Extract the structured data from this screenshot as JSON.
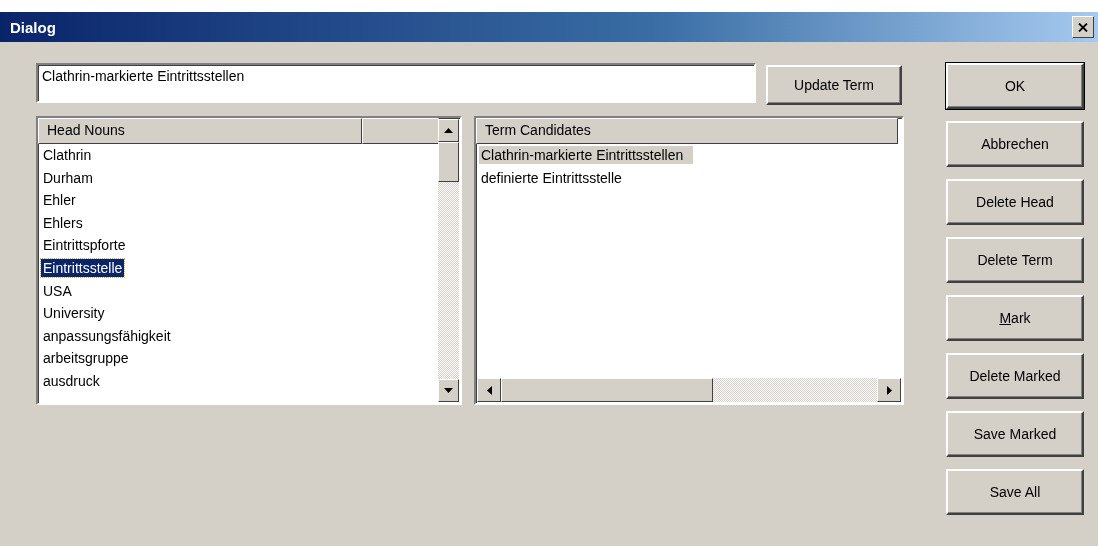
{
  "window": {
    "title": "Dialog"
  },
  "term_field": {
    "value": "Clathrin-markierte Eintrittsstellen"
  },
  "update_button": {
    "label": "Update Term"
  },
  "head_nouns": {
    "columns": [
      "Head Nouns"
    ],
    "rows": [
      {
        "label": "Clathrin",
        "selected": false
      },
      {
        "label": "Durham",
        "selected": false
      },
      {
        "label": "Ehler",
        "selected": false
      },
      {
        "label": "Ehlers",
        "selected": false
      },
      {
        "label": "Eintrittspforte",
        "selected": false
      },
      {
        "label": "Eintrittsstelle",
        "selected": true
      },
      {
        "label": "USA",
        "selected": false
      },
      {
        "label": "University",
        "selected": false
      },
      {
        "label": "anpassungsfähigkeit",
        "selected": false
      },
      {
        "label": "arbeitsgruppe",
        "selected": false
      },
      {
        "label": "ausdruck",
        "selected": false
      }
    ]
  },
  "term_candidates": {
    "columns": [
      "Term Candidates"
    ],
    "rows": [
      {
        "label": "Clathrin-markierte Eintrittsstellen",
        "selected": true
      },
      {
        "label": "definierte Eintrittsstelle",
        "selected": false
      }
    ]
  },
  "buttons": [
    {
      "label": "OK",
      "default": true
    },
    {
      "label": "Abbrechen",
      "default": false
    },
    {
      "label": "Delete Head",
      "default": false
    },
    {
      "label": "Delete Term",
      "default": false
    },
    {
      "label_parts": [
        {
          "text": "M",
          "underlined": true
        },
        {
          "text": "ark",
          "underlined": false
        }
      ],
      "default": false
    },
    {
      "label": "Delete Marked",
      "default": false
    },
    {
      "label": "Save Marked",
      "default": false
    },
    {
      "label": "Save All",
      "default": false
    }
  ]
}
